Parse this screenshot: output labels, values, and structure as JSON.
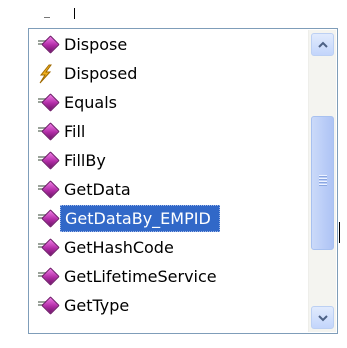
{
  "popup": {
    "items": [
      {
        "label": "Dispose",
        "icon": "method-icon",
        "selected": false
      },
      {
        "label": "Disposed",
        "icon": "event-icon",
        "selected": false
      },
      {
        "label": "Equals",
        "icon": "method-icon",
        "selected": false
      },
      {
        "label": "Fill",
        "icon": "method-icon",
        "selected": false
      },
      {
        "label": "FillBy",
        "icon": "method-icon",
        "selected": false
      },
      {
        "label": "GetData",
        "icon": "method-icon",
        "selected": false
      },
      {
        "label": "GetDataBy_EMPID",
        "icon": "method-icon",
        "selected": true
      },
      {
        "label": "GetHashCode",
        "icon": "method-icon",
        "selected": false
      },
      {
        "label": "GetLifetimeService",
        "icon": "method-icon",
        "selected": false
      },
      {
        "label": "GetType",
        "icon": "method-icon",
        "selected": false
      }
    ]
  },
  "scrollbar": {
    "position_fraction": 0.35,
    "up_icon": "chevron-up-icon",
    "down_icon": "chevron-down-icon"
  },
  "colors": {
    "selection": "#3168c8",
    "method_icon": "#b12ca6",
    "event_icon": "#e0a010",
    "scrollbar": "#c3d5fb"
  }
}
